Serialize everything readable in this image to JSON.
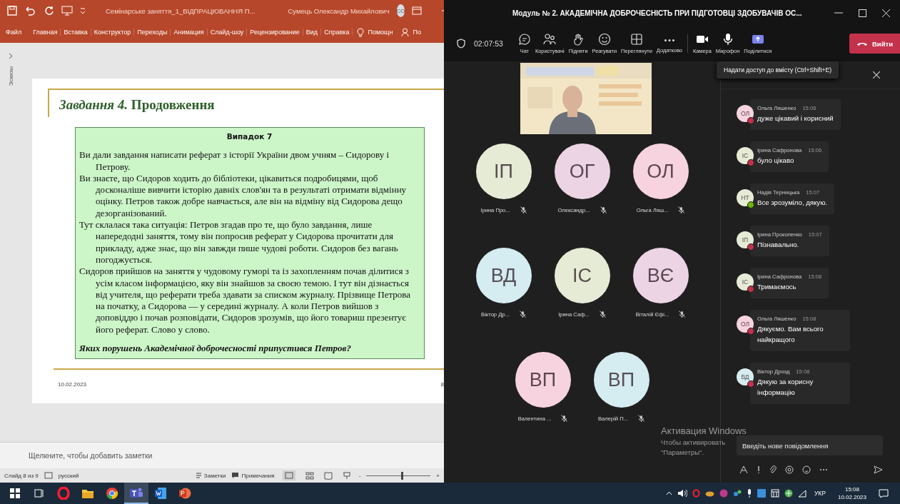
{
  "powerpoint": {
    "title": "Семінарське заняття_1_ВІДПРАЦЮВАННЯ П...",
    "user": "Сумець Олександр Михайлович",
    "user_initials": "СО",
    "ribbon_tabs": [
      {
        "label": "Файл",
        "kind": "tab"
      },
      {
        "label": "Главная",
        "kind": "tab"
      },
      {
        "label": "Вставка",
        "kind": "tab"
      },
      {
        "label": "Конструктор",
        "kind": "tab"
      },
      {
        "label": "Переходы",
        "kind": "tab"
      },
      {
        "label": "Анимация",
        "kind": "tab"
      },
      {
        "label": "Слайд-шоу",
        "kind": "tab"
      },
      {
        "label": "Рецензирование",
        "kind": "tab"
      },
      {
        "label": "Вид",
        "kind": "tab"
      },
      {
        "label": "Справка",
        "kind": "tab"
      },
      {
        "label": "Помощн",
        "kind": "tell"
      },
      {
        "label": "По",
        "kind": "share"
      }
    ],
    "thumbnails_label": "Эскизы",
    "slide": {
      "title": "*Завдання 4.* Продовження",
      "case_title": "Випадок 7",
      "paragraphs": [
        "Ви дали завдання написати реферат з історії України двом учням – Сидорову і Петрову.",
        "Ви знаєте, що Сидоров ходить до бібліотеки, цікавиться подробицями, щоб досконаліше вивчити історію давніх слов'ян та в результаті отримати відмінну оцінку. Петров також добре навчається, але він на відміну від Сидорова дещо дезорганізований.",
        "Тут склалася така ситуація: Петров згадав про те, що було завдання, лише напередодні заняття, тому він попросив реферат у Сидорова прочитати для прикладу, адже знає, що він завжди пише чудові роботи. Сидоров без вагань погоджується.",
        "Сидоров прийшов на заняття у чудовому гуморі та із захопленням почав ділитися з усім класом інформацією, яку він знайшов за своєю темою. І тут він дізнається від учителя, що реферати треба здавати за списком журналу. Прізвище Петрова на початку, а Сидорова — у середині журналу. А коли Петров вийшов з доповіддю і почав розповідати, Сидоров зрозумів, що його товариш презентує його реферат. Слово у слово."
      ],
      "question": "Яких порушень Академічної доброчесності припустився Петров?",
      "date": "10.02.2023",
      "number": "8"
    },
    "notes_placeholder": "Щелкните, чтобы добавить заметки",
    "status": {
      "slide": "Слайд 8 из 9",
      "language": "русский",
      "notes": "Заметки",
      "comments": "Примечания",
      "minus": "-",
      "plus": "+",
      "zoom": {
        "level": 0.55
      }
    }
  },
  "teams": {
    "title": "Модуль № 2. АКАДЕМІЧНА ДОБРОЧЕСНІСТЬ ПРИ ПІДГОТОВЦІ ЗДОБУВАЧІВ ОС...",
    "timer": "02:07:53",
    "tools": [
      {
        "label": "Чат",
        "kind": "chat"
      },
      {
        "label": "Користувачі",
        "kind": "users"
      },
      {
        "label": "Підняти",
        "kind": "hand"
      },
      {
        "label": "Реагувати",
        "kind": "smile"
      },
      {
        "label": "Переглянути",
        "kind": "grid"
      },
      {
        "label": "Додатково",
        "kind": "more"
      }
    ],
    "devices": [
      {
        "label": "Камера",
        "kind": "camera"
      },
      {
        "label": "Мікрофон",
        "kind": "mic"
      },
      {
        "label": "Поділитися",
        "kind": "share"
      }
    ],
    "leave": "Вийти",
    "tooltip": "Надати доступ до вмісту (Ctrl+Shift+E)",
    "participants": [
      {
        "initials": "ІП",
        "name": "Ірина Про...",
        "color": "#e6ebd6"
      },
      {
        "initials": "ОГ",
        "name": "Олександр...",
        "color": "#ecd4e4"
      },
      {
        "initials": "ОЛ",
        "name": "Ольга Ляш...",
        "color": "#f6d3de"
      },
      {
        "initials": "ВД",
        "name": "Віктор Др...",
        "color": "#d5ecf1"
      },
      {
        "initials": "ІС",
        "name": "Ірина Саф...",
        "color": "#e6ebd6"
      },
      {
        "initials": "ВЄ",
        "name": "Віталій Єфі...",
        "color": "#ecd4e4"
      },
      {
        "initials": "ВП",
        "name": "Валентина ...",
        "color": "#f6d3de"
      },
      {
        "initials": "ВП",
        "name": "Валерій П...",
        "color": "#d5ecf1"
      }
    ],
    "chat": {
      "messages": [
        {
          "avatar": {
            "initials": "ОЛ",
            "color": "#f6d3de"
          },
          "presence": {
            "color": "#c4314b"
          },
          "author": "Ольга Ляшенко",
          "time": "15:06",
          "text": "дуже цікавий і корисний"
        },
        {
          "avatar": {
            "initials": "ІС",
            "color": "#e6ebd6"
          },
          "presence": {
            "color": "#c4314b"
          },
          "author": "Ірина Сафронова",
          "time": "15:06",
          "text": "було цікаво"
        },
        {
          "avatar": {
            "initials": "НТ",
            "color": "#e6ebd6"
          },
          "presence": {
            "color": "#6bb700"
          },
          "author": "Надія Терницька",
          "time": "15:07",
          "text": "Все зрозуміло, дякую."
        },
        {
          "avatar": {
            "initials": "ІП",
            "color": "#e6ebd6"
          },
          "presence": {
            "color": "#c4314b"
          },
          "author": "Ірина Прокопенко",
          "time": "15:07",
          "text": "Пізнавально."
        },
        {
          "avatar": {
            "initials": "ІС",
            "color": "#e6ebd6"
          },
          "presence": {
            "color": "#c4314b"
          },
          "author": "Ірина Сафронова",
          "time": "15:08",
          "text": "Тримаємось"
        },
        {
          "avatar": {
            "initials": "ОЛ",
            "color": "#f6d3de"
          },
          "presence": {
            "color": "#c4314b"
          },
          "author": "Ольга Ляшенко",
          "time": "15:08",
          "text": "Дякуємо. Вам всього найкращого"
        },
        {
          "avatar": {
            "initials": "ВД",
            "color": "#d5ecf1"
          },
          "presence": {
            "color": "#c4314b"
          },
          "author": "Віктор Дрозд",
          "time": "15:08",
          "text": "Дякую за корисну інформацію"
        }
      ],
      "input_placeholder": "Введіть нове повідомлення"
    },
    "watermark": {
      "title": "Активация Windows",
      "lines": [
        "Чтобы активировать",
        "\"Параметры\"."
      ]
    }
  },
  "taskbar": {
    "apps": [
      {
        "kind": "start",
        "active": false
      },
      {
        "kind": "taskview",
        "active": false
      },
      {
        "kind": "opera",
        "active": false
      },
      {
        "kind": "explorer",
        "active": false
      },
      {
        "kind": "chrome",
        "active": false
      },
      {
        "kind": "teams",
        "active": true
      },
      {
        "kind": "word",
        "active": false
      },
      {
        "kind": "powerpoint",
        "active": false
      }
    ],
    "language": "УКР",
    "time": "15:08",
    "date": "10.02.2023"
  }
}
